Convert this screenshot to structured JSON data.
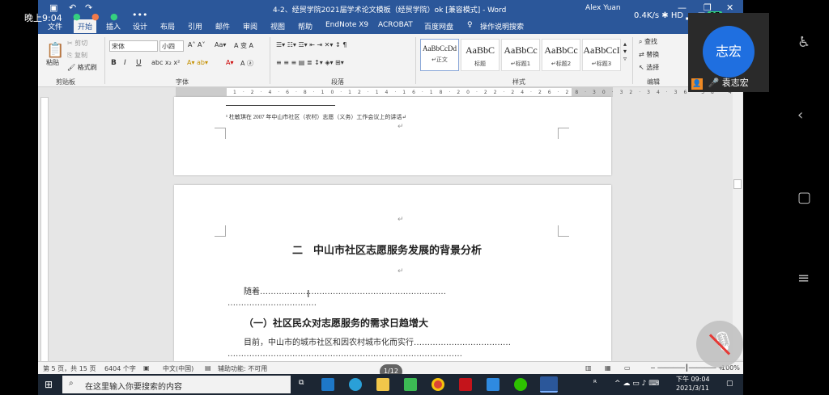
{
  "phone": {
    "status_time": "晚上9:04",
    "net_speed": "0.4K/s",
    "battery": "87",
    "speaker_name": "袁志宏",
    "speaker_avatar_text": "志宏",
    "page_indicator": "1/12"
  },
  "word": {
    "title": "4-2、经贸学院2021届学术论文模板（经贸学院）ok [兼容模式] - Word",
    "user": "Alex Yuan",
    "tabs": [
      "文件",
      "开始",
      "插入",
      "设计",
      "布局",
      "引用",
      "邮件",
      "审阅",
      "视图",
      "帮助",
      "EndNote X9",
      "ACROBAT",
      "百度网盘",
      "操作说明搜索"
    ],
    "active_tab": "开始",
    "ribbon": {
      "clipboard": {
        "paste": "粘贴",
        "cut": "剪切",
        "copy": "复制",
        "format_painter": "格式刷",
        "label": "剪贴板"
      },
      "font": {
        "font_name": "宋体",
        "font_size": "小四",
        "label": "字体"
      },
      "paragraph": {
        "label": "段落"
      },
      "styles": {
        "items": [
          {
            "preview": "AaBbCcDd",
            "name": "↵正文"
          },
          {
            "preview": "AaBbC",
            "name": "标题"
          },
          {
            "preview": "AaBbCc",
            "name": "↵标题1"
          },
          {
            "preview": "AaBbCc",
            "name": "↵标题2"
          },
          {
            "preview": "AaBbCcI",
            "name": "↵标题3"
          }
        ],
        "label": "样式"
      },
      "editing": {
        "find": "查找",
        "replace": "替换",
        "select": "选择",
        "label": "编辑"
      }
    },
    "document": {
      "footnote": "¹ 杜敏琪在 2007 年中山市社区（农村）志愿（义务）工作会议上的讲话↵",
      "heading": "二　中山市社区志愿服务发展的背景分析",
      "para1": "随着……………………………………………………………",
      "para1b": "……………………………",
      "subheading": "（一）社区民众对志愿服务的需求日趋增大",
      "para2": "目前，中山市的城市社区和因农村城市化而实行………………………………",
      "para2b": "……………………………………………………………………………"
    },
    "status": {
      "page": "第 5 页，共 15 页",
      "words": "6404 个字",
      "lang": "中文(中国)",
      "accessibility": "辅助功能: 不可用",
      "zoom": "100%"
    }
  },
  "taskbar": {
    "search_placeholder": "在这里输入你要搜索的内容",
    "time": "下午 09:04",
    "date": "2021/3/11"
  }
}
